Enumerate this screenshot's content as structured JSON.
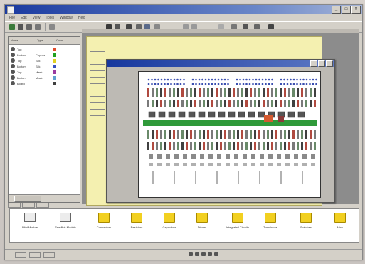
{
  "window": {
    "title": ""
  },
  "menubar": {
    "items": [
      "File",
      "Edit",
      "View",
      "Tools",
      "Window",
      "Help"
    ]
  },
  "layers": {
    "columns": [
      "Name",
      "Type",
      "Color"
    ],
    "rows": [
      {
        "name": "Top",
        "type": "",
        "color": "#e24a2a"
      },
      {
        "name": "Bottom",
        "type": "Copper",
        "color": "#20a020"
      },
      {
        "name": "Top",
        "type": "Silk",
        "color": "#e0d020"
      },
      {
        "name": "Bottom",
        "type": "Silk",
        "color": "#3a50c0"
      },
      {
        "name": "Top",
        "type": "Mask",
        "color": "#9a3aa0"
      },
      {
        "name": "Bottom",
        "type": "Mask",
        "color": "#60a0d0"
      },
      {
        "name": "Board",
        "type": "",
        "color": "#404040"
      }
    ]
  },
  "palette": {
    "items": [
      {
        "label": "Pilot Module",
        "icon": "module-icon"
      },
      {
        "label": "Seedlink Module",
        "icon": "module-icon"
      },
      {
        "label": "Connectors",
        "icon": "folder-icon"
      },
      {
        "label": "Resistors",
        "icon": "folder-icon"
      },
      {
        "label": "Capacitors",
        "icon": "folder-icon"
      },
      {
        "label": "Diodes",
        "icon": "folder-icon"
      },
      {
        "label": "Integrated Circuits",
        "icon": "folder-icon"
      },
      {
        "label": "Transistors",
        "icon": "folder-icon"
      },
      {
        "label": "Switches",
        "icon": "folder-icon"
      },
      {
        "label": "Misc",
        "icon": "folder-icon"
      }
    ]
  },
  "colors": {
    "titlebar": "#1a3aa0",
    "document": "#f4f0b0",
    "palette_folder": "#f2d020"
  }
}
